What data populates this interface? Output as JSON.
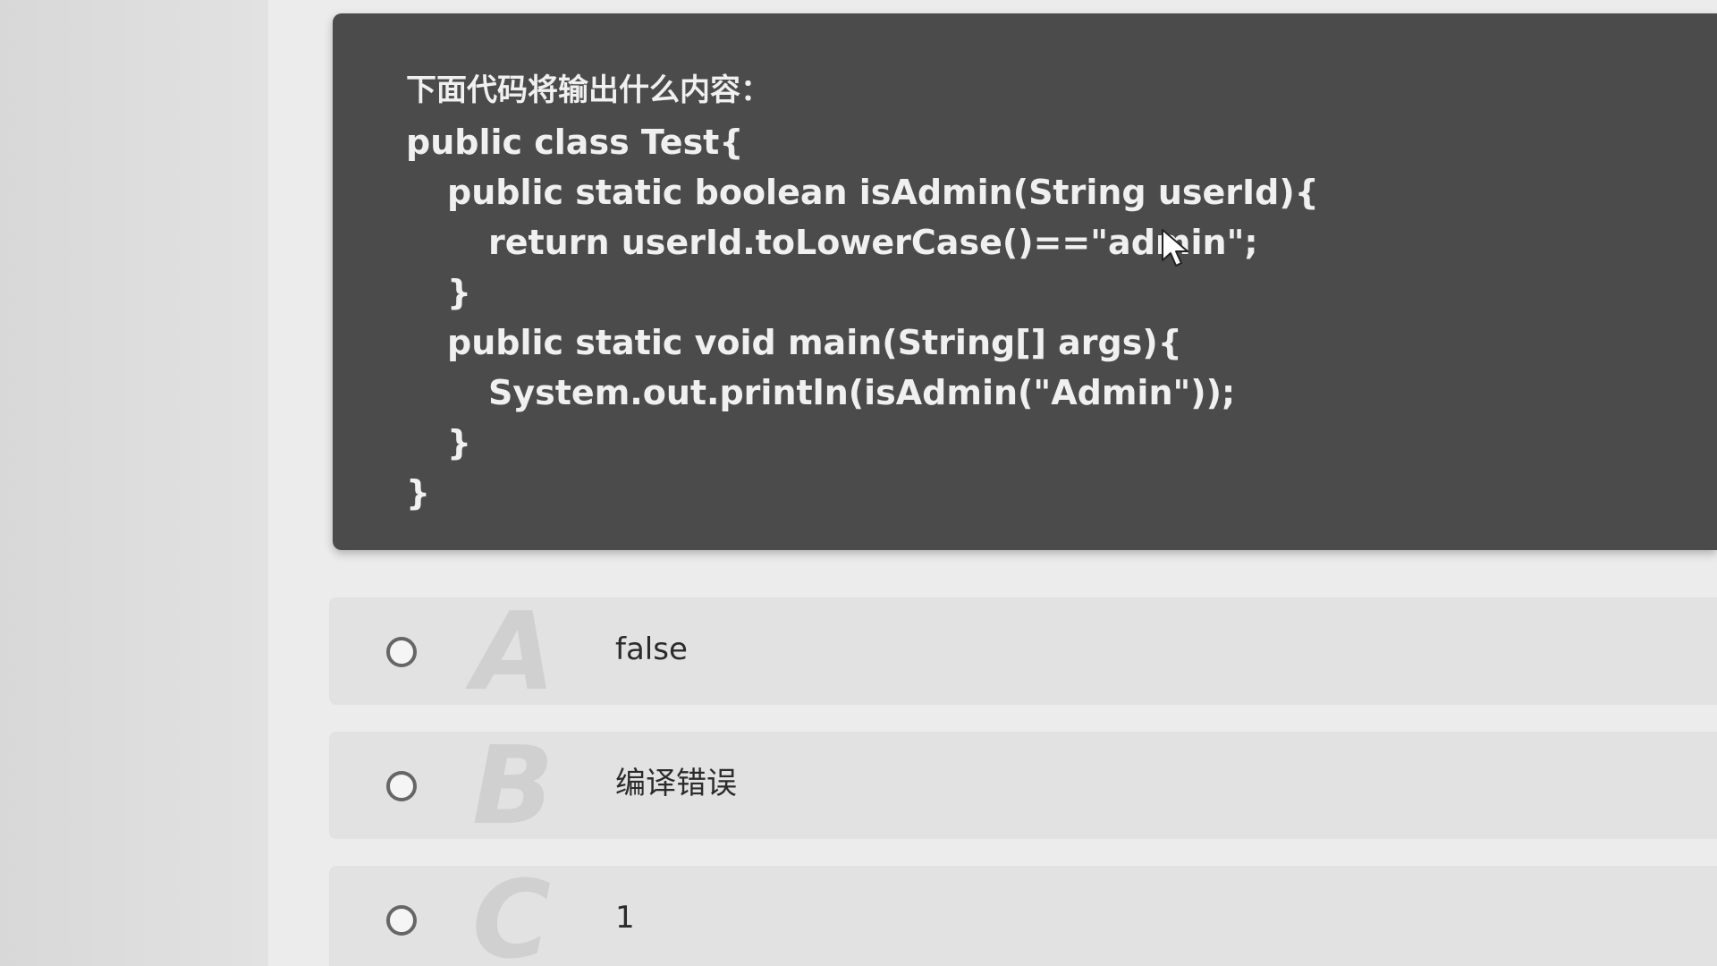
{
  "question": {
    "prompt": "下面代码将输出什么内容：",
    "code_lines": [
      "public class Test{",
      "public static boolean isAdmin(String userId){",
      "return userId.toLowerCase()==\"admin\";",
      "}",
      "public static void main(String[] args){",
      "System.out.println(isAdmin(\"Admin\"));",
      "}",
      "}"
    ]
  },
  "options": [
    {
      "letter": "A",
      "text": "false"
    },
    {
      "letter": "B",
      "text": "编译错误"
    },
    {
      "letter": "C",
      "text": "1"
    }
  ],
  "icons": {
    "cursor": "mouse-pointer-icon",
    "radio": "radio-unchecked-icon"
  },
  "colors": {
    "panel_bg": "#4a4b4a",
    "panel_text": "#f0f0f0",
    "option_bg": "#e2e2e2",
    "letter_watermark": "#d0d0d0"
  }
}
